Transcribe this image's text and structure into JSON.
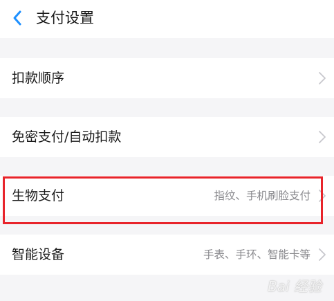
{
  "header": {
    "title": "支付设置",
    "back_icon": "chevron-left-icon"
  },
  "rows": [
    {
      "label": "扣款顺序",
      "value": ""
    },
    {
      "label": "免密支付/自动扣款",
      "value": ""
    },
    {
      "label": "生物支付",
      "value": "指纹、手机刷脸支付"
    },
    {
      "label": "智能设备",
      "value": "手表、手环、智能卡等"
    }
  ],
  "annotation": {
    "highlight_color": "#e8242b"
  },
  "watermark": {
    "text": "Bai 经验"
  },
  "colors": {
    "accent": "#1e90ff",
    "background": "#f5f5f7",
    "row_background": "#ffffff",
    "secondary_text": "#8a8a8e",
    "chevron": "#c7c7cc"
  }
}
